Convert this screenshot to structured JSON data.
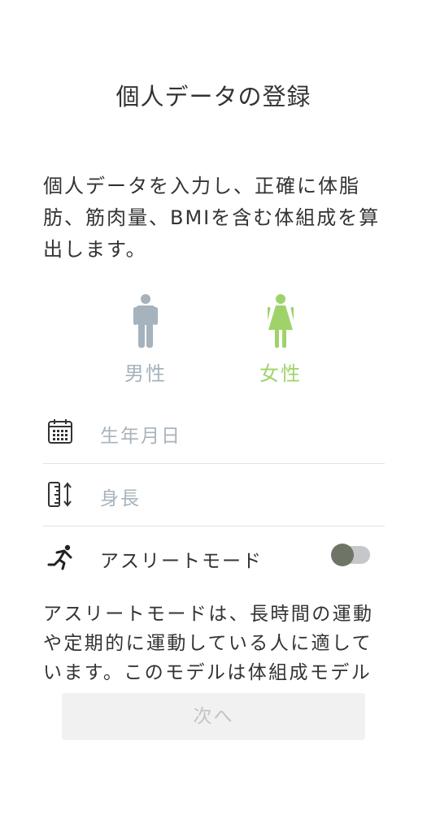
{
  "header": {
    "title": "個人データの登録"
  },
  "intro_text": "個人データを入力し、正確に体脂肪、筋肉量、BMIを含む体組成を算出します。",
  "gender": {
    "male": {
      "label": "男性",
      "icon": "male-person-icon",
      "color": "#a6b2bc"
    },
    "female": {
      "label": "女性",
      "icon": "female-person-icon",
      "color": "#9fd36a"
    },
    "selected": "female"
  },
  "form": {
    "birth_date": {
      "placeholder": "生年月日",
      "icon": "calendar-icon"
    },
    "height": {
      "placeholder": "身長",
      "icon": "ruler-height-icon"
    },
    "athlete_mode": {
      "label": "アスリートモード",
      "icon": "runner-icon",
      "enabled": false
    }
  },
  "athlete_description": "アスリートモードは、長時間の運動や定期的に運動している人に適しています。このモデルは体組成モデル",
  "next_button": {
    "label": "次へ",
    "disabled": true
  }
}
